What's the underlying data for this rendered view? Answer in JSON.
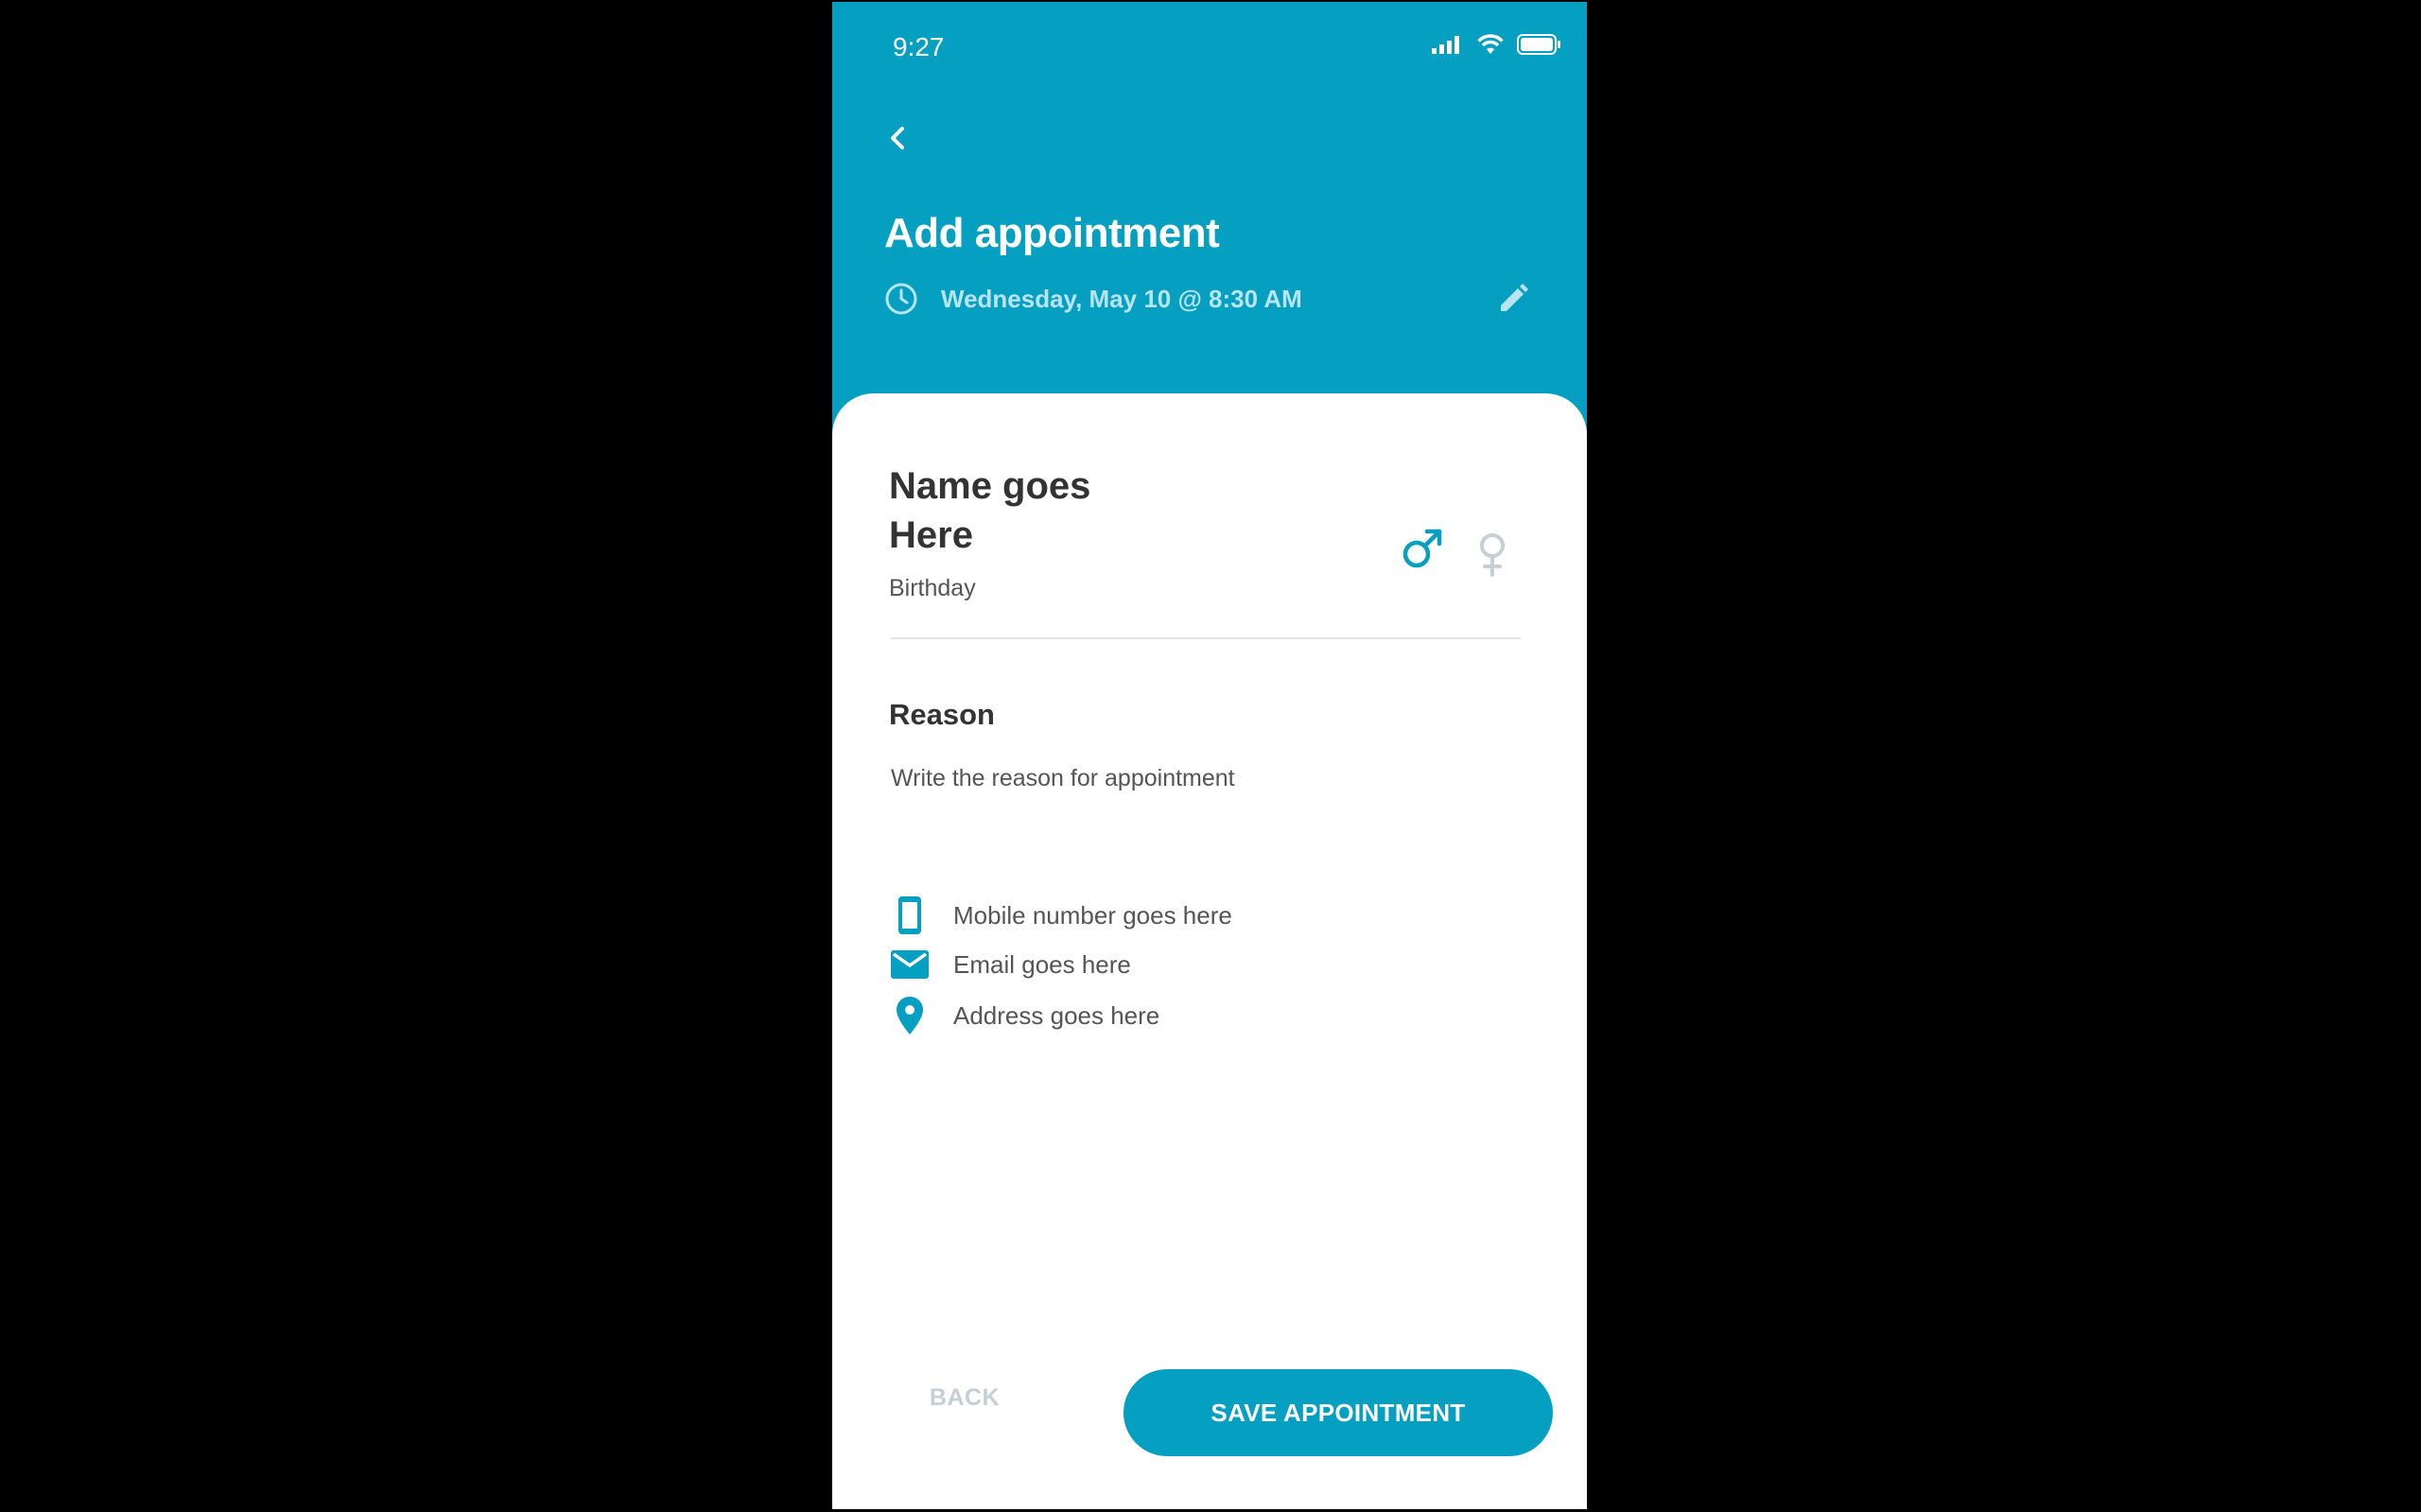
{
  "status_bar": {
    "time": "9:27"
  },
  "header": {
    "title": "Add appointment",
    "datetime": "Wednesday, May 10 @ 8:30 AM"
  },
  "patient": {
    "name": "Name goes Here",
    "birthday": "Birthday",
    "gender_selected": "male"
  },
  "reason": {
    "label": "Reason",
    "placeholder": "Write the reason for appointment"
  },
  "contact": {
    "mobile": "Mobile number goes here",
    "email": "Email goes here",
    "address": "Address goes here"
  },
  "footer": {
    "back_label": "BACK",
    "save_label": "SAVE APPOINTMENT"
  },
  "colors": {
    "primary": "#059fc1",
    "subtext_on_primary": "#b7e4ef",
    "inactive": "#c4cfd6"
  }
}
